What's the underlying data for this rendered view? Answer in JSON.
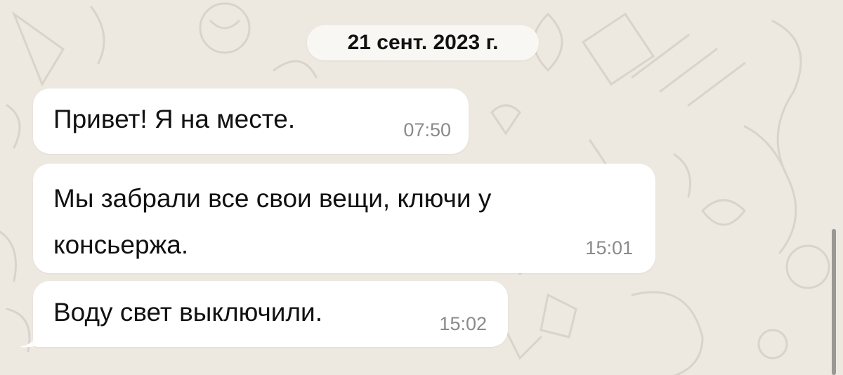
{
  "chat": {
    "date_label": "21 сент. 2023 г.",
    "messages": [
      {
        "text": "Привет! Я на месте.",
        "time": "07:50"
      },
      {
        "text": "Мы забрали все свои вещи,  ключи у консьержа.",
        "time": "15:01"
      },
      {
        "text": "Воду свет выключили.",
        "time": "15:02"
      }
    ]
  },
  "colors": {
    "background": "#ede9e1",
    "bubble": "#ffffff",
    "timestamp": "#8a8a8a"
  }
}
